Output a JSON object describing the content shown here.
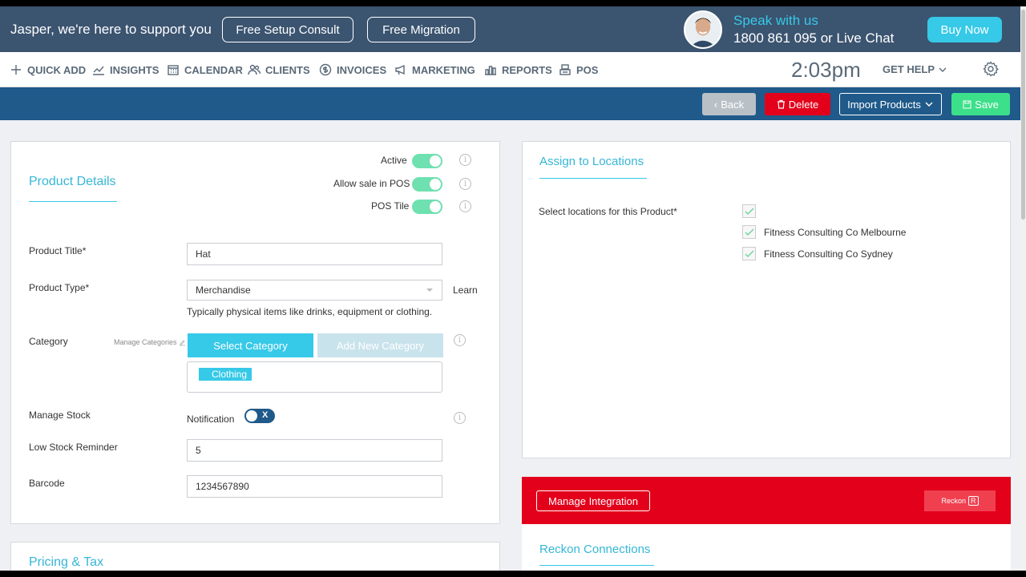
{
  "support": {
    "message": "Jasper, we're here to support you",
    "setup_btn": "Free Setup Consult",
    "migration_btn": "Free Migration",
    "speak": "Speak with us",
    "phone": "1800 861 095 or Live Chat",
    "buy_now": "Buy Now"
  },
  "nav": {
    "items": [
      "QUICK ADD",
      "INSIGHTS",
      "CALENDAR",
      "CLIENTS",
      "INVOICES",
      "MARKETING",
      "REPORTS",
      "POS"
    ],
    "time": "2:03pm",
    "get_help": "GET HELP"
  },
  "actions": {
    "back": "Back",
    "delete": "Delete",
    "import": "Import Products",
    "save": "Save"
  },
  "product": {
    "section_title": "Product Details",
    "active_label": "Active",
    "allow_pos_label": "Allow sale in POS",
    "pos_tile_label": "POS Tile",
    "title_label": "Product Title*",
    "title_value": "Hat",
    "type_label": "Product Type*",
    "type_value": "Merchandise",
    "learn": "Learn",
    "type_hint": "Typically physical items like drinks, equipment or clothing.",
    "category_label": "Category",
    "manage_categories": "Manage Categories",
    "select_category": "Select Category",
    "add_category": "Add New Category",
    "category_tag": "Clothing",
    "manage_stock_label": "Manage Stock",
    "notification_label": "Notification",
    "toggle_x": "X",
    "low_stock_label": "Low Stock Reminder",
    "low_stock_value": "5",
    "barcode_label": "Barcode",
    "barcode_value": "1234567890"
  },
  "pricing": {
    "section_title": "Pricing & Tax"
  },
  "locations": {
    "section_title": "Assign to Locations",
    "select_label": "Select locations for this Product*",
    "items": [
      "Fitness Consulting Co Melbourne",
      "Fitness Consulting Co Sydney"
    ]
  },
  "integration": {
    "manage_btn": "Manage Integration",
    "logo_text": "Reckon",
    "logo_mark": "R",
    "connections_title": "Reckon Connections"
  },
  "colors": {
    "accent": "#36c9e8",
    "support_bar": "#3b5470",
    "action_bar": "#1f5a8a",
    "danger": "#e3001b",
    "success": "#3de08a"
  }
}
